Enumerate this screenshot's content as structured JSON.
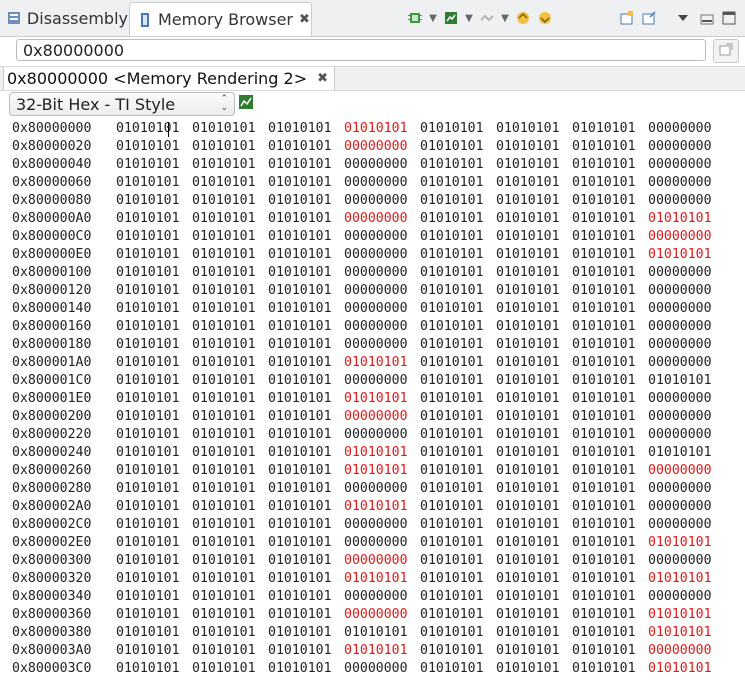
{
  "tabs": {
    "disassembly": "Disassembly",
    "memory_browser": "Memory Browser"
  },
  "address_input": "0x80000000",
  "rendering_tab": "0x80000000 <Memory Rendering 2>",
  "format_select": "32-Bit Hex - TI Style",
  "colors": {
    "changed": "#e01818",
    "normal": "#222222"
  },
  "icons": [
    "disassembly-icon",
    "memory-browser-icon",
    "chip-icon",
    "memory-icon",
    "connect-icon",
    "import-icon",
    "export-icon",
    "new-view-icon",
    "pin-icon",
    "view-menu-icon",
    "minimize-icon",
    "maximize-icon",
    "go-icon",
    "rendering-icon"
  ],
  "rows": [
    {
      "addr": "0x80000000",
      "w": [
        "01010101",
        "01010101",
        "01010101",
        "01010101",
        "01010101",
        "01010101",
        "01010101",
        "00000000"
      ],
      "r": [
        3
      ]
    },
    {
      "addr": "0x80000020",
      "w": [
        "01010101",
        "01010101",
        "01010101",
        "00000000",
        "01010101",
        "01010101",
        "01010101",
        "00000000"
      ],
      "r": [
        3
      ]
    },
    {
      "addr": "0x80000040",
      "w": [
        "01010101",
        "01010101",
        "01010101",
        "00000000",
        "01010101",
        "01010101",
        "01010101",
        "00000000"
      ],
      "r": []
    },
    {
      "addr": "0x80000060",
      "w": [
        "01010101",
        "01010101",
        "01010101",
        "00000000",
        "01010101",
        "01010101",
        "01010101",
        "00000000"
      ],
      "r": []
    },
    {
      "addr": "0x80000080",
      "w": [
        "01010101",
        "01010101",
        "01010101",
        "00000000",
        "01010101",
        "01010101",
        "01010101",
        "00000000"
      ],
      "r": []
    },
    {
      "addr": "0x800000A0",
      "w": [
        "01010101",
        "01010101",
        "01010101",
        "00000000",
        "01010101",
        "01010101",
        "01010101",
        "01010101"
      ],
      "r": [
        3,
        7
      ]
    },
    {
      "addr": "0x800000C0",
      "w": [
        "01010101",
        "01010101",
        "01010101",
        "00000000",
        "01010101",
        "01010101",
        "01010101",
        "00000000"
      ],
      "r": [
        7
      ]
    },
    {
      "addr": "0x800000E0",
      "w": [
        "01010101",
        "01010101",
        "01010101",
        "00000000",
        "01010101",
        "01010101",
        "01010101",
        "01010101"
      ],
      "r": [
        7
      ]
    },
    {
      "addr": "0x80000100",
      "w": [
        "01010101",
        "01010101",
        "01010101",
        "00000000",
        "01010101",
        "01010101",
        "01010101",
        "00000000"
      ],
      "r": []
    },
    {
      "addr": "0x80000120",
      "w": [
        "01010101",
        "01010101",
        "01010101",
        "00000000",
        "01010101",
        "01010101",
        "01010101",
        "00000000"
      ],
      "r": []
    },
    {
      "addr": "0x80000140",
      "w": [
        "01010101",
        "01010101",
        "01010101",
        "00000000",
        "01010101",
        "01010101",
        "01010101",
        "00000000"
      ],
      "r": []
    },
    {
      "addr": "0x80000160",
      "w": [
        "01010101",
        "01010101",
        "01010101",
        "00000000",
        "01010101",
        "01010101",
        "01010101",
        "00000000"
      ],
      "r": []
    },
    {
      "addr": "0x80000180",
      "w": [
        "01010101",
        "01010101",
        "01010101",
        "00000000",
        "01010101",
        "01010101",
        "01010101",
        "00000000"
      ],
      "r": []
    },
    {
      "addr": "0x800001A0",
      "w": [
        "01010101",
        "01010101",
        "01010101",
        "01010101",
        "01010101",
        "01010101",
        "01010101",
        "00000000"
      ],
      "r": [
        3
      ]
    },
    {
      "addr": "0x800001C0",
      "w": [
        "01010101",
        "01010101",
        "01010101",
        "00000000",
        "01010101",
        "01010101",
        "01010101",
        "01010101"
      ],
      "r": []
    },
    {
      "addr": "0x800001E0",
      "w": [
        "01010101",
        "01010101",
        "01010101",
        "01010101",
        "01010101",
        "01010101",
        "01010101",
        "00000000"
      ],
      "r": [
        3
      ]
    },
    {
      "addr": "0x80000200",
      "w": [
        "01010101",
        "01010101",
        "01010101",
        "00000000",
        "01010101",
        "01010101",
        "01010101",
        "00000000"
      ],
      "r": [
        3
      ]
    },
    {
      "addr": "0x80000220",
      "w": [
        "01010101",
        "01010101",
        "01010101",
        "00000000",
        "01010101",
        "01010101",
        "01010101",
        "00000000"
      ],
      "r": []
    },
    {
      "addr": "0x80000240",
      "w": [
        "01010101",
        "01010101",
        "01010101",
        "01010101",
        "01010101",
        "01010101",
        "01010101",
        "01010101"
      ],
      "r": [
        3
      ]
    },
    {
      "addr": "0x80000260",
      "w": [
        "01010101",
        "01010101",
        "01010101",
        "01010101",
        "01010101",
        "01010101",
        "01010101",
        "00000000"
      ],
      "r": [
        3,
        7
      ]
    },
    {
      "addr": "0x80000280",
      "w": [
        "01010101",
        "01010101",
        "01010101",
        "00000000",
        "01010101",
        "01010101",
        "01010101",
        "00000000"
      ],
      "r": []
    },
    {
      "addr": "0x800002A0",
      "w": [
        "01010101",
        "01010101",
        "01010101",
        "01010101",
        "01010101",
        "01010101",
        "01010101",
        "00000000"
      ],
      "r": [
        3
      ]
    },
    {
      "addr": "0x800002C0",
      "w": [
        "01010101",
        "01010101",
        "01010101",
        "00000000",
        "01010101",
        "01010101",
        "01010101",
        "00000000"
      ],
      "r": []
    },
    {
      "addr": "0x800002E0",
      "w": [
        "01010101",
        "01010101",
        "01010101",
        "00000000",
        "01010101",
        "01010101",
        "01010101",
        "01010101"
      ],
      "r": [
        7
      ]
    },
    {
      "addr": "0x80000300",
      "w": [
        "01010101",
        "01010101",
        "01010101",
        "00000000",
        "01010101",
        "01010101",
        "01010101",
        "00000000"
      ],
      "r": [
        3
      ]
    },
    {
      "addr": "0x80000320",
      "w": [
        "01010101",
        "01010101",
        "01010101",
        "01010101",
        "01010101",
        "01010101",
        "01010101",
        "01010101"
      ],
      "r": [
        3,
        7
      ]
    },
    {
      "addr": "0x80000340",
      "w": [
        "01010101",
        "01010101",
        "01010101",
        "00000000",
        "01010101",
        "01010101",
        "01010101",
        "00000000"
      ],
      "r": []
    },
    {
      "addr": "0x80000360",
      "w": [
        "01010101",
        "01010101",
        "01010101",
        "00000000",
        "01010101",
        "01010101",
        "01010101",
        "01010101"
      ],
      "r": [
        3,
        7
      ]
    },
    {
      "addr": "0x80000380",
      "w": [
        "01010101",
        "01010101",
        "01010101",
        "01010101",
        "01010101",
        "01010101",
        "01010101",
        "01010101"
      ],
      "r": [
        7
      ]
    },
    {
      "addr": "0x800003A0",
      "w": [
        "01010101",
        "01010101",
        "01010101",
        "01010101",
        "01010101",
        "01010101",
        "01010101",
        "00000000"
      ],
      "r": [
        3,
        7
      ]
    },
    {
      "addr": "0x800003C0",
      "w": [
        "01010101",
        "01010101",
        "01010101",
        "00000000",
        "01010101",
        "01010101",
        "01010101",
        "01010101"
      ],
      "r": [
        7
      ]
    }
  ]
}
